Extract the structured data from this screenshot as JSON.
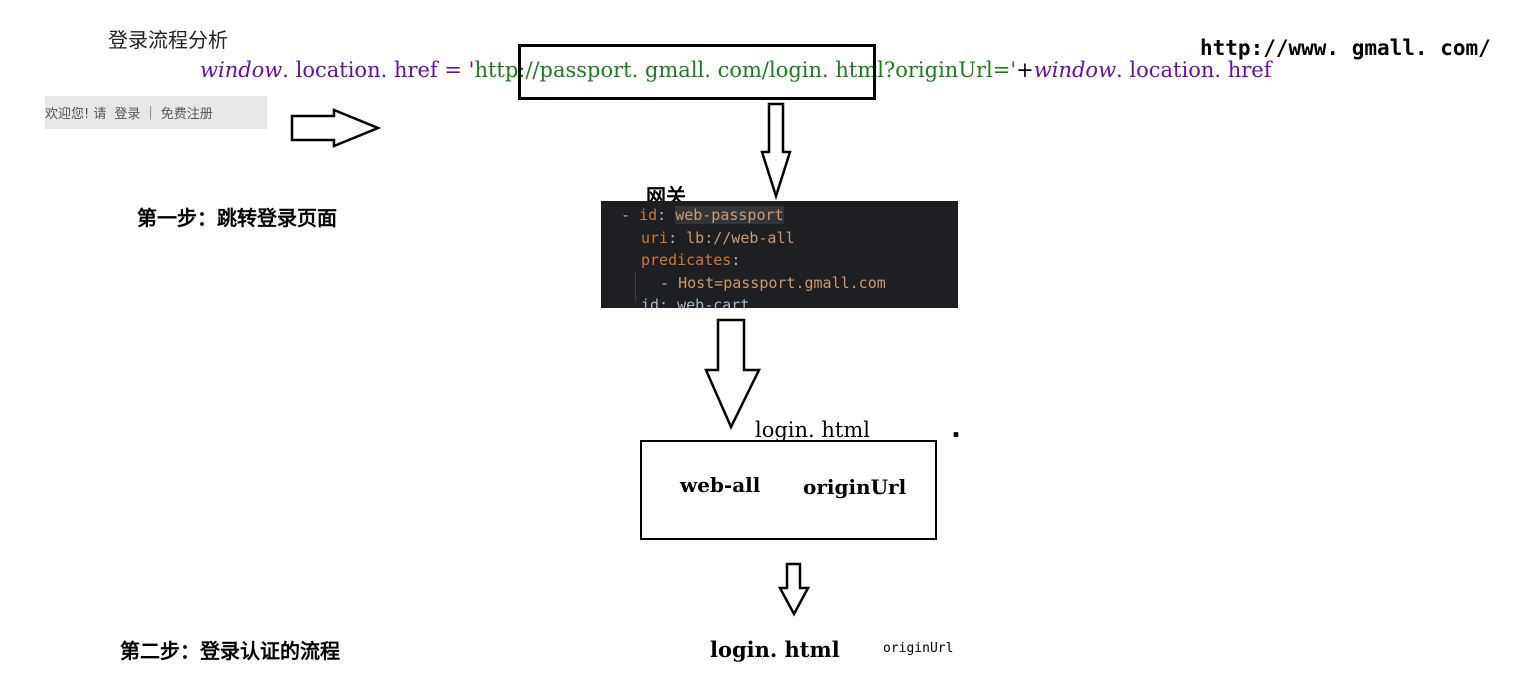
{
  "title": "登录流程分析",
  "href_line": {
    "window1": "window",
    "mid": ". location. href = '",
    "url": "http://passport. gmall. com/login. html?originUrl='",
    "plus": "+",
    "window2": "window",
    "end": ". location. href"
  },
  "gmall_url": "http://www. gmall. com/",
  "login_bar": {
    "welcome": "欢迎您! 请",
    "login": "登录",
    "separator": "|",
    "register": "免费注册"
  },
  "step1": "第一步：跳转登录页面",
  "step2": "第二步：登录认证的流程",
  "gateway_label": "网关",
  "code": {
    "line1_dash": "- ",
    "line1_key": "id",
    "line1_colon": ": ",
    "line1_val": "web-passport",
    "line2_key": "uri",
    "line2_colon": ": ",
    "line2_val": "lb://web-all",
    "line3_key": "predicates",
    "line3_colon": ":",
    "line4_dash": "- ",
    "line4_val": "Host=passport.gmall.com",
    "line5": "id: web-cart"
  },
  "box": {
    "web_all": "web-all",
    "origin_url": "originUrl"
  },
  "login_html_1": "login. html",
  "dot": ".",
  "login_html_2": "login. html",
  "origin_small": "originUrl",
  "colors": {
    "code_bg": "#1e1f22",
    "key": "#cc7832",
    "string": "#6a8759",
    "purple": "#6a0dad",
    "green": "#1a7f1a"
  },
  "icons": [
    "right-arrow-icon",
    "down-arrow-icon"
  ]
}
